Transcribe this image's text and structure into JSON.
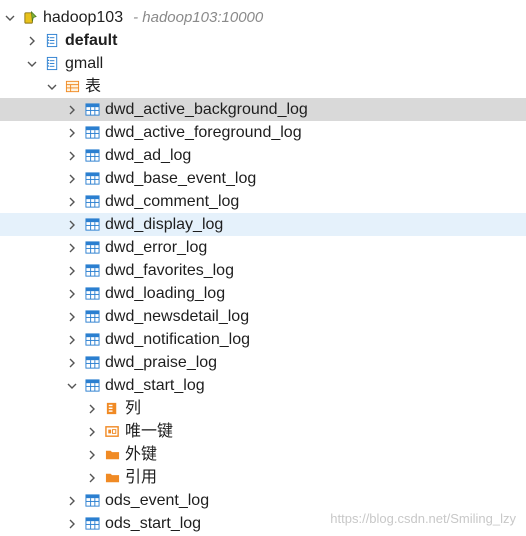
{
  "connection": {
    "name": "hadoop103",
    "address": "- hadoop103:10000"
  },
  "databases": [
    {
      "name": "default",
      "bold": true,
      "expanded": false
    },
    {
      "name": "gmall",
      "bold": false,
      "expanded": true
    }
  ],
  "folder_tables": "表",
  "tables": [
    "dwd_active_background_log",
    "dwd_active_foreground_log",
    "dwd_ad_log",
    "dwd_base_event_log",
    "dwd_comment_log",
    "dwd_display_log",
    "dwd_error_log",
    "dwd_favorites_log",
    "dwd_loading_log",
    "dwd_newsdetail_log",
    "dwd_notification_log",
    "dwd_praise_log",
    "dwd_start_log"
  ],
  "start_log_children": [
    "列",
    "唯一键",
    "外键",
    "引用"
  ],
  "more_tables": [
    "ods_event_log",
    "ods_start_log"
  ],
  "watermark": "https://blog.csdn.net/Smiling_lzy",
  "colors": {
    "selected_row": "#d9d9d9",
    "hover_row": "#e5f1fb",
    "table_icon": "#2b7fd0",
    "folder_icon": "#f08a24"
  }
}
